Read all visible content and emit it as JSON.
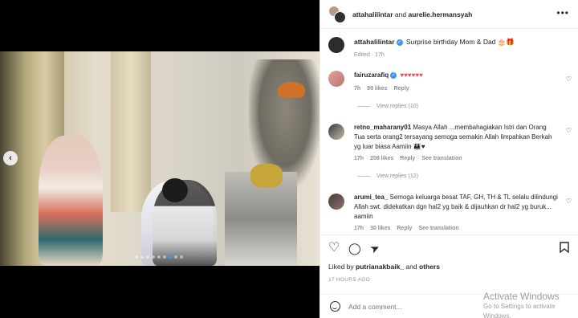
{
  "header": {
    "user1": "attahalilintar",
    "connector": "and",
    "user2": "aurelie.hermansyah",
    "more_icon": "more-horizontal-icon"
  },
  "media": {
    "prev_icon": "chevron-left-icon",
    "prev_glyph": "‹",
    "slides": 9,
    "active_slide": 6
  },
  "caption": {
    "username": "attahalilintar",
    "text": "Surprise birthday Mom & Dad 🎂🎁",
    "edited": "Edited",
    "age": "17h"
  },
  "comments": [
    {
      "username": "fairuzarafiq",
      "text": "♥♥♥♥♥♥",
      "age": "7h",
      "likes": "99 likes",
      "reply": "Reply",
      "view_replies": "View replies (10)"
    },
    {
      "username": "retno_maharany01",
      "text": "Masya Allah ...membahagiakan Istri dan Orang Tua serta orang2 tersayang semoga semakin Allah limpahkan Berkah yg luar biasa Aamiin 👨‍👩‍👧♥",
      "age": "17h",
      "likes": "208 likes",
      "reply": "Reply",
      "see_translation": "See translation",
      "view_replies": "View replies (12)"
    },
    {
      "username": "arumi_tea_",
      "text": "Semoga keluarga besat TAF, GH, TH & TL selalu dilindungi Allah swt. didekatkan dgn hal2 yg baik & dijauhkan dr hal2 yg buruk... aamiin",
      "age": "17h",
      "likes": "30 likes",
      "reply": "Reply",
      "see_translation": "See translation"
    }
  ],
  "actions": {
    "like_glyph": "♡",
    "comment_glyph": "◯",
    "share_glyph": "➤",
    "save_glyph": "⚑"
  },
  "likes": {
    "prefix": "Liked by",
    "user": "putrianakbaik_",
    "and": "and",
    "others": "others"
  },
  "timestamp": "17 HOURS AGO",
  "add_comment": {
    "placeholder": "Add a comment..."
  },
  "watermark": {
    "title": "Activate Windows",
    "subtitle": "Go to Settings to activate Windows."
  },
  "colors": {
    "link_blue": "#3897f0",
    "muted": "#8e8e8e",
    "heart_red": "#ed4956"
  }
}
